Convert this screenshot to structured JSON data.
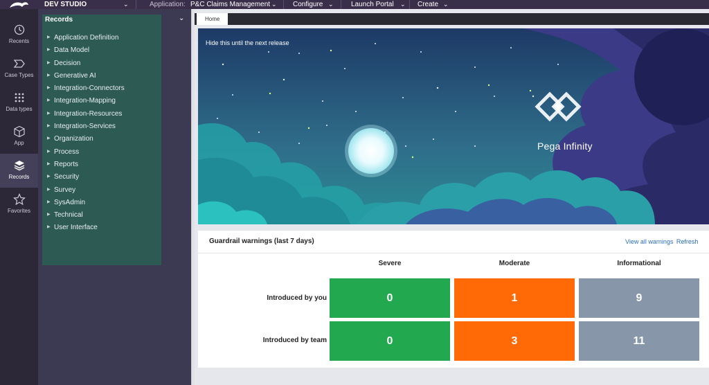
{
  "header": {
    "studio": "DEV STUDIO",
    "app_label": "Application:",
    "app_name": "P&C Claims Management",
    "menus": [
      "Configure",
      "Launch Portal",
      "Create"
    ]
  },
  "rail": [
    {
      "label": "Recents",
      "icon": "history-icon"
    },
    {
      "label": "Case Types",
      "icon": "case-types-icon"
    },
    {
      "label": "Data types",
      "icon": "data-types-icon"
    },
    {
      "label": "App",
      "icon": "cube-icon"
    },
    {
      "label": "Records",
      "icon": "layers-icon",
      "active": true
    },
    {
      "label": "Favorites",
      "icon": "star-icon"
    }
  ],
  "records": {
    "title": "Records",
    "items": [
      "Application Definition",
      "Data Model",
      "Decision",
      "Generative AI",
      "Integration-Connectors",
      "Integration-Mapping",
      "Integration-Resources",
      "Integration-Services",
      "Organization",
      "Process",
      "Reports",
      "Security",
      "Survey",
      "SysAdmin",
      "Technical",
      "User Interface"
    ]
  },
  "tabs": [
    "Home"
  ],
  "banner": {
    "message": "Hide this until the next release",
    "brand": "Pega Infinity"
  },
  "guardrails": {
    "title": "Guardrail warnings (last 7 days)",
    "view_all": "View all warnings",
    "refresh": "Refresh",
    "columns": [
      "Severe",
      "Moderate",
      "Informational"
    ],
    "rows": [
      {
        "label": "Introduced by you",
        "values": [
          "0",
          "1",
          "9"
        ]
      },
      {
        "label": "Introduced by team",
        "values": [
          "0",
          "3",
          "11"
        ]
      }
    ],
    "colors": {
      "severe": "#22a84f",
      "moderate": "#ff6a07",
      "informational": "#8796a8"
    }
  }
}
